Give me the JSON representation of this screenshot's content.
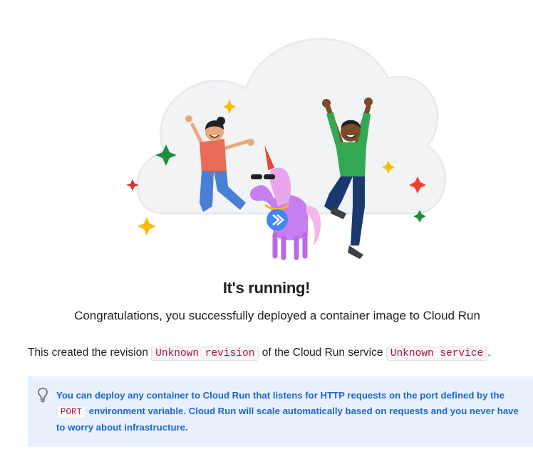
{
  "heading": {
    "title": "It's running!",
    "subtitle": "Congratulations, you successfully deployed a container image to Cloud Run"
  },
  "revision_line": {
    "prefix": "This created the revision",
    "revision": "Unknown revision",
    "middle": "of the Cloud Run service",
    "service": "Unknown service",
    "suffix": "."
  },
  "tip": {
    "icon": "lightbulb-icon",
    "text_before": "You can deploy any container to Cloud Run that listens for HTTP requests on the port defined by the",
    "code": "PORT",
    "text_after": "environment variable. Cloud Run will scale automatically based on requests and you never have to worry about infrastructure."
  },
  "colors": {
    "tip_background": "#e8f0fe",
    "tip_text": "#1967d2",
    "code_text": "#b5114a",
    "cloud": "#f1f3f4"
  }
}
